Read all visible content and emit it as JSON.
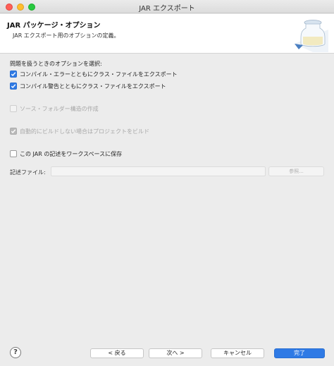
{
  "window": {
    "title": "JAR エクスポート"
  },
  "header": {
    "title": "JAR パッケージ・オプション",
    "description": "JAR エクスポート用のオプションの定義。",
    "graphic_icon": "jar-icon"
  },
  "options": {
    "group_label": "問題を扱うときのオプションを選択:",
    "export_with_errors": {
      "label": "コンパイル・エラーとともにクラス・ファイルをエクスポート",
      "checked": true,
      "enabled": true
    },
    "export_with_warnings": {
      "label": "コンパイル警告とともにクラス・ファイルをエクスポート",
      "checked": true,
      "enabled": true
    },
    "create_source_folder_structure": {
      "label": "ソース・フォルダー構造の作成",
      "checked": false,
      "enabled": false
    },
    "build_projects": {
      "label": "自動的にビルドしない場合はプロジェクトをビルド",
      "checked": true,
      "enabled": false
    },
    "save_description": {
      "label": "この JAR の記述をワークスペースに保存",
      "checked": false,
      "enabled": true
    }
  },
  "description_file": {
    "label": "記述ファイル:",
    "value": "",
    "browse_label": "参照..."
  },
  "footer": {
    "help_glyph": "?",
    "back_label": "< 戻る",
    "next_label": "次へ >",
    "cancel_label": "キャンセル",
    "finish_label": "完了"
  },
  "colors": {
    "accent": "#2f7ae5",
    "close": "#ff5f57",
    "minimize": "#ffbd2e",
    "maximize": "#28c940"
  }
}
